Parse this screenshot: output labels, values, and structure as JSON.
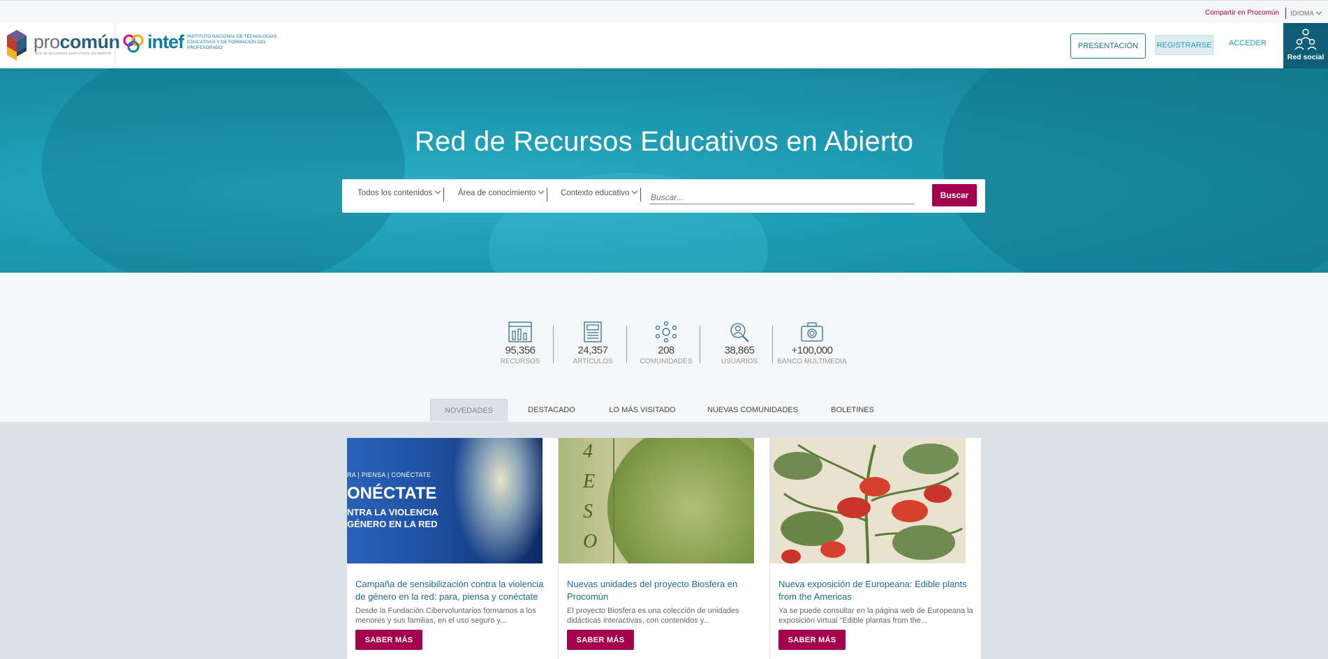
{
  "topbar": {
    "share_label": "Compartir en Procomún",
    "language_label": "IDIOMA"
  },
  "header": {
    "logo": {
      "pro": "pro",
      "comun": "común",
      "subtitle": "RED DE RECURSOS EDUCATIVOS EN ABIERTO"
    },
    "intef": {
      "word": "intef",
      "description": "INSTITUTO NACIONAL DE TECNOLOGÍAS EDUCATIVAS Y DE FORMACIÓN DEL PROFESORADO"
    },
    "presentation_label": "PRESENTACIÓN",
    "register_label": "REGISTRARSE",
    "login_label": "ACCEDER",
    "social_label": "Red social"
  },
  "hero": {
    "title": "Red de Recursos Educativos en Abierto",
    "filters": [
      {
        "label": "Todos los contenidos"
      },
      {
        "label": "Área de conocimiento"
      },
      {
        "label": "Contexto educativo"
      }
    ],
    "search_placeholder": "Buscar...",
    "search_button": "Buscar"
  },
  "stats": [
    {
      "value": "95,356",
      "label": "RECURSOS",
      "icon": "resources-icon"
    },
    {
      "value": "24,357",
      "label": "ARTÍCULOS",
      "icon": "articles-icon"
    },
    {
      "value": "208",
      "label": "COMUNIDADES",
      "icon": "communities-icon"
    },
    {
      "value": "38,865",
      "label": "USUARIOS",
      "icon": "users-icon"
    },
    {
      "value": "+100,000",
      "label": "BANCO MULTIMEDIA",
      "icon": "camera-icon"
    }
  ],
  "tabs": [
    {
      "label": "NOVEDADES",
      "active": true
    },
    {
      "label": "DESTACADO"
    },
    {
      "label": "LO MÁS VISITADO"
    },
    {
      "label": "NUEVAS COMUNIDADES"
    },
    {
      "label": "BOLETINES"
    }
  ],
  "cards": [
    {
      "title": "Campaña de sensibilización contra la violencia de género en la red: para, piensa y conéctate",
      "description": "Desde la Fundación Cibervoluntarios formamos a los menores y sus familias, en el uso seguro y...",
      "button": "SABER MÁS",
      "image_text": {
        "top": "RA | PIENSA | CONÉCTATE",
        "main": "ONÉCTATE",
        "line1": "NTRA LA VIOLENCIA",
        "line2": "GÉNERO EN LA RED"
      }
    },
    {
      "title": "Nuevas unidades del proyecto Biosfera en Procomún",
      "description": "El proyecto Biosfera es una colección de unidades didácticas interactivas, con contenidos y...",
      "button": "SABER MÁS",
      "image_text": {
        "letters": [
          "4",
          "E",
          "S",
          "O"
        ]
      }
    },
    {
      "title": "Nueva exposición de Europeana: Edible plants from the Americas",
      "description": "Ya se puede consultar en la página web de Europeana la exposición virtual \"Edible plantas from the...",
      "button": "SABER MÁS"
    }
  ],
  "colors": {
    "brand_magenta": "#a3004e",
    "brand_teal": "#1a7f98",
    "hero_teal": "#1e9db4",
    "social_dark": "#0f5d77"
  }
}
